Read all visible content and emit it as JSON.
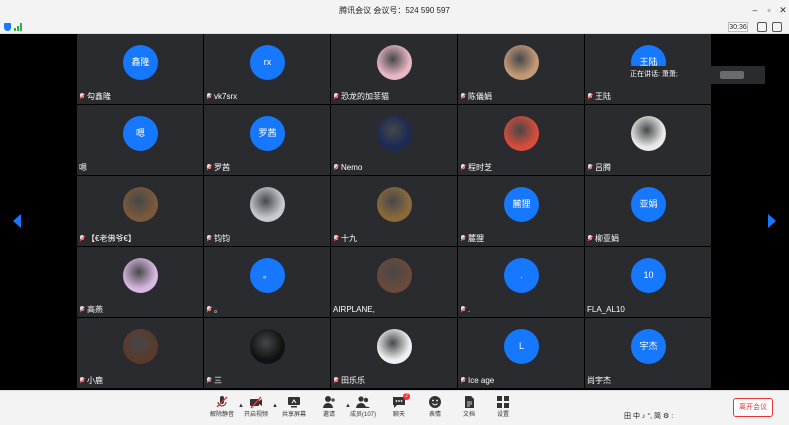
{
  "window": {
    "title": "腾讯会议 会议号：524 590 597",
    "timer": "30:36"
  },
  "grid": {
    "tiles": [
      {
        "avatar_text": "鑫隆",
        "name": "勾鑫隆",
        "muted": true,
        "photo": false
      },
      {
        "avatar_text": "rx",
        "name": "vk7srx",
        "muted": true,
        "photo": false
      },
      {
        "avatar_text": "",
        "name": "恐龙的加菲猫",
        "muted": true,
        "photo": true,
        "color": "#e8b7c4"
      },
      {
        "avatar_text": "",
        "name": "陈儀娟",
        "muted": true,
        "photo": true,
        "color": "#c49a76"
      },
      {
        "avatar_text": "王陆",
        "name": "王陆",
        "muted": true,
        "photo": false
      },
      {
        "avatar_text": "嗯",
        "name": "嗯",
        "muted": false,
        "photo": false
      },
      {
        "avatar_text": "罗茜",
        "name": "罗茜",
        "muted": true,
        "photo": false
      },
      {
        "avatar_text": "",
        "name": "Nemo",
        "muted": true,
        "photo": true,
        "color": "#1a2a55"
      },
      {
        "avatar_text": "",
        "name": "程时芝",
        "muted": true,
        "photo": true,
        "color": "#d84c3a"
      },
      {
        "avatar_text": "",
        "name": "吕腾",
        "muted": true,
        "photo": true,
        "color": "#e9e9e9"
      },
      {
        "avatar_text": "",
        "name": "【€老佛爷€】",
        "muted": true,
        "photo": true,
        "color": "#7a5a3a"
      },
      {
        "avatar_text": "",
        "name": "钧钧",
        "muted": true,
        "photo": true,
        "color": "#c8c8d0"
      },
      {
        "avatar_text": "",
        "name": "十九",
        "muted": true,
        "photo": true,
        "color": "#8a6a3a"
      },
      {
        "avatar_text": "麓狸",
        "name": "麓狸",
        "muted": true,
        "photo": false
      },
      {
        "avatar_text": "亚娟",
        "name": "柳亚娟",
        "muted": true,
        "photo": false
      },
      {
        "avatar_text": "",
        "name": "高燕",
        "muted": true,
        "photo": true,
        "color": "#d7b8e0"
      },
      {
        "avatar_text": "。",
        "name": "。",
        "muted": true,
        "photo": false
      },
      {
        "avatar_text": "",
        "name": "AIRPLANE,",
        "muted": false,
        "photo": true,
        "color": "#6a4a3a"
      },
      {
        "avatar_text": ".",
        "name": ".",
        "muted": true,
        "photo": false
      },
      {
        "avatar_text": "10",
        "name": "FLA_AL10",
        "muted": false,
        "photo": false
      },
      {
        "avatar_text": "",
        "name": "小鹿",
        "muted": true,
        "photo": true,
        "color": "#5a3a2a"
      },
      {
        "avatar_text": "",
        "name": "三",
        "muted": true,
        "photo": true,
        "color": "#111111"
      },
      {
        "avatar_text": "",
        "name": "田乐乐",
        "muted": true,
        "photo": true,
        "color": "#f0f0f0"
      },
      {
        "avatar_text": "L",
        "name": "Ice age",
        "muted": true,
        "photo": false
      },
      {
        "avatar_text": "宇杰",
        "name": "尚宇杰",
        "muted": false,
        "photo": false
      }
    ]
  },
  "speaker": {
    "label": "正在讲话: 萧萧;"
  },
  "toolbar": {
    "items": [
      {
        "label": "解除静音",
        "icon": "mic-muted-icon"
      },
      {
        "label": "开启视频",
        "icon": "camera-off-icon"
      },
      {
        "label": "共享屏幕",
        "icon": "share-screen-icon"
      },
      {
        "label": "邀请",
        "icon": "invite-icon"
      },
      {
        "label": "成员(107)",
        "icon": "members-icon"
      },
      {
        "label": "聊天",
        "icon": "chat-icon",
        "badge": "2"
      },
      {
        "label": "表情",
        "icon": "emoji-icon"
      },
      {
        "label": "文档",
        "icon": "document-icon"
      },
      {
        "label": "设置",
        "icon": "settings-icon"
      }
    ],
    "leave_label": "离开会议"
  },
  "ime": {
    "text": "田 中 ♪ °, 简 ⚙ :"
  },
  "colors": {
    "accent": "#1677ff",
    "tile_bg": "#2a2b2e",
    "danger": "#e33333"
  }
}
